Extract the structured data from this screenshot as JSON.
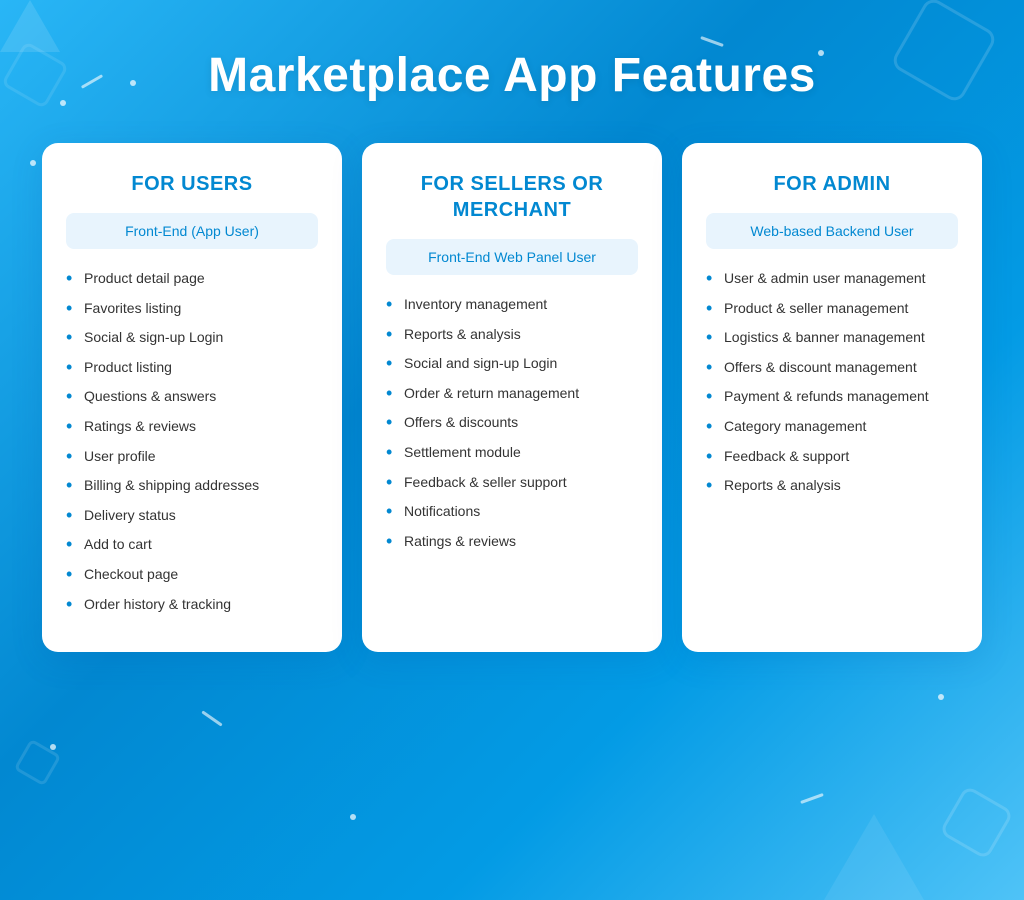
{
  "page": {
    "title": "Marketplace App Features",
    "background_colors": [
      "#29b6f6",
      "#0288d1"
    ]
  },
  "columns": [
    {
      "id": "users",
      "header": "FOR USERS",
      "subtitle": "Front-End (App User)",
      "features": [
        "Product detail page",
        "Favorites listing",
        "Social & sign-up Login",
        "Product listing",
        "Questions & answers",
        "Ratings & reviews",
        "User profile",
        "Billing & shipping addresses",
        "Delivery status",
        "Add to cart",
        "Checkout page",
        "Order history & tracking"
      ]
    },
    {
      "id": "sellers",
      "header": "FOR SELLERS OR MERCHANT",
      "subtitle": "Front-End Web Panel User",
      "features": [
        "Inventory management",
        "Reports & analysis",
        "Social and sign-up Login",
        "Order & return management",
        "Offers & discounts",
        "Settlement module",
        "Feedback & seller support",
        "Notifications",
        "Ratings & reviews"
      ]
    },
    {
      "id": "admin",
      "header": "FOR ADMIN",
      "subtitle": "Web-based Backend User",
      "features": [
        "User & admin user management",
        "Product & seller management",
        "Logistics & banner management",
        "Offers & discount management",
        "Payment & refunds management",
        "Category management",
        "Feedback & support",
        "Reports & analysis"
      ]
    }
  ]
}
